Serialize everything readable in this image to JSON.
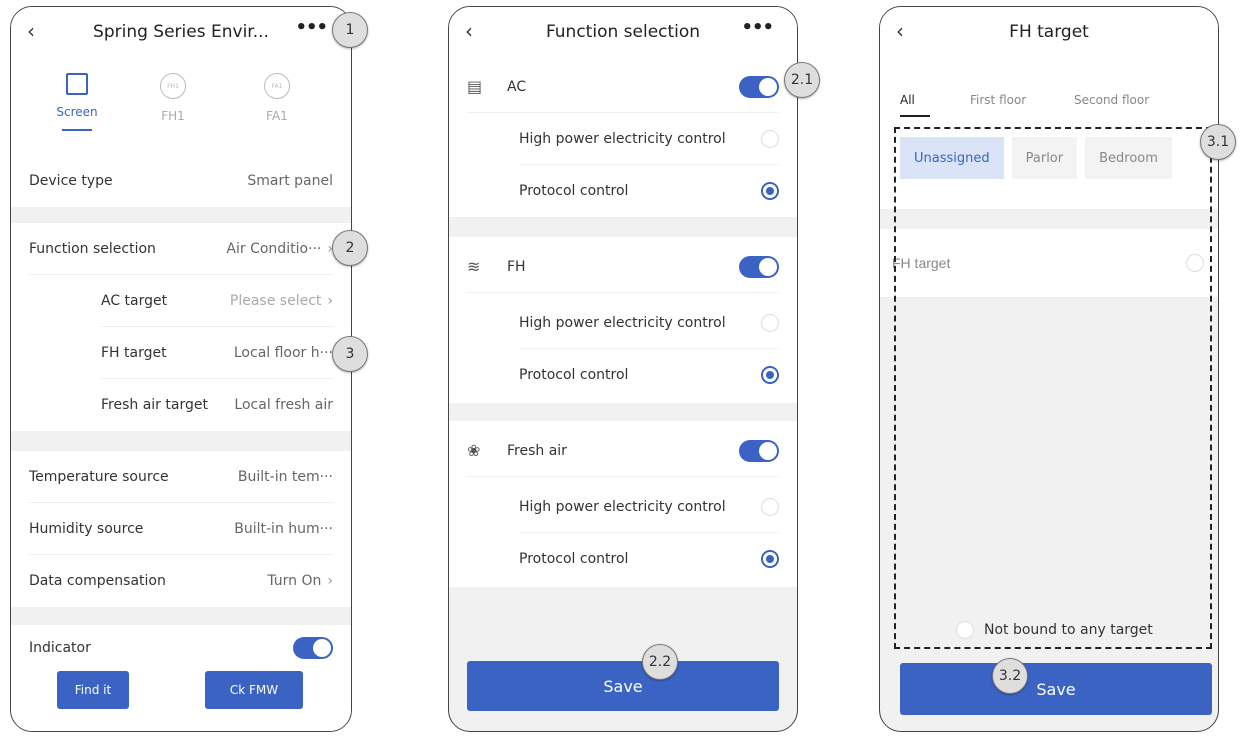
{
  "screen1": {
    "title": "Spring Series Envir...",
    "callout_more": "1",
    "callout_function": "2",
    "callout_fh": "3",
    "tabs": [
      {
        "label": "Screen",
        "icon": "screen-icon",
        "glyph": ""
      },
      {
        "label": "FH1",
        "icon": "fh1-icon",
        "glyph": "FH1"
      },
      {
        "label": "FA1",
        "icon": "fa1-icon",
        "glyph": "FA1"
      }
    ],
    "device_type": {
      "label": "Device type",
      "value": "Smart panel"
    },
    "function_selection": {
      "label": "Function selection",
      "value": "Air Conditio···"
    },
    "ac_target": {
      "label": "AC target",
      "value": "Please select"
    },
    "fh_target": {
      "label": "FH target",
      "value": "Local floor h···"
    },
    "fresh_air_target": {
      "label": "Fresh air target",
      "value": "Local fresh air"
    },
    "temperature_source": {
      "label": "Temperature source",
      "value": "Built-in tem···"
    },
    "humidity_source": {
      "label": "Humidity source",
      "value": "Built-in hum···"
    },
    "data_compensation": {
      "label": "Data compensation",
      "value": "Turn On"
    },
    "indicator": {
      "label": "Indicator",
      "on": true
    },
    "find_it": "Find it",
    "ck_fmw": "Ck FMW"
  },
  "screen2": {
    "title": "Function selection",
    "callout_toggle": "2.1",
    "callout_save": "2.2",
    "groups": [
      {
        "label": "AC",
        "icon": "ac-unit-icon",
        "on": true,
        "options": [
          {
            "label": "High power electricity control",
            "selected": false
          },
          {
            "label": "Protocol control",
            "selected": true
          }
        ]
      },
      {
        "label": "FH",
        "icon": "floor-heating-icon",
        "on": true,
        "options": [
          {
            "label": "High power electricity control",
            "selected": false
          },
          {
            "label": "Protocol control",
            "selected": true
          }
        ]
      },
      {
        "label": "Fresh air",
        "icon": "fresh-air-icon",
        "on": true,
        "options": [
          {
            "label": "High power electricity control",
            "selected": false
          },
          {
            "label": "Protocol control",
            "selected": true
          }
        ]
      }
    ],
    "save": "Save"
  },
  "screen3": {
    "title": "FH target",
    "callout_area": "3.1",
    "callout_save": "3.2",
    "floor_tabs": [
      "All",
      "First floor",
      "Second floor"
    ],
    "rooms": [
      {
        "label": "Unassigned",
        "selected": true
      },
      {
        "label": "Parlor",
        "selected": false
      },
      {
        "label": "Bedroom",
        "selected": false
      }
    ],
    "target_item": "FH target",
    "not_bound": "Not bound to any target",
    "save": "Save"
  },
  "colors": {
    "accent": "#3a63c4",
    "background": "#f1f1f1"
  }
}
